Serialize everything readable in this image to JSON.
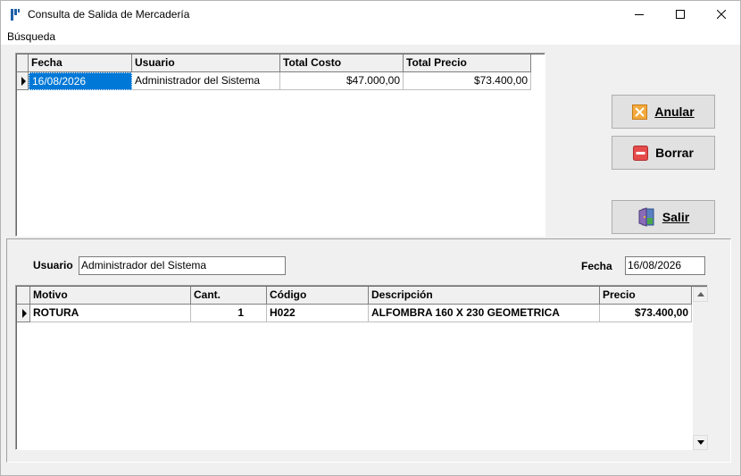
{
  "window": {
    "title": "Consulta de Salida de Mercadería"
  },
  "menu": {
    "busqueda": "Búsqueda"
  },
  "master_grid": {
    "columns": [
      "Fecha",
      "Usuario",
      "Total Costo",
      "Total Precio"
    ],
    "rows": [
      {
        "fecha": "16/08/2026",
        "usuario": "Administrador del Sistema",
        "total_costo": "$47.000,00",
        "total_precio": "$73.400,00"
      }
    ]
  },
  "buttons": {
    "anular": "Anular",
    "borrar": "Borrar",
    "salir": "Salir"
  },
  "detail": {
    "usuario_label": "Usuario",
    "usuario_value": "Administrador del Sistema",
    "fecha_label": "Fecha",
    "fecha_value": "16/08/2026"
  },
  "detail_grid": {
    "columns": [
      "Motivo",
      "Cant.",
      "Código",
      "Descripción",
      "Precio"
    ],
    "rows": [
      {
        "motivo": "ROTURA",
        "cant": "1",
        "codigo": "H022",
        "descripcion": "ALFOMBRA 160 X 230 GEOMETRICA",
        "precio": "$73.400,00"
      }
    ]
  },
  "colors": {
    "selection": "#0078d7",
    "anular_icon": "#f0a030",
    "borrar_icon": "#e04040"
  }
}
